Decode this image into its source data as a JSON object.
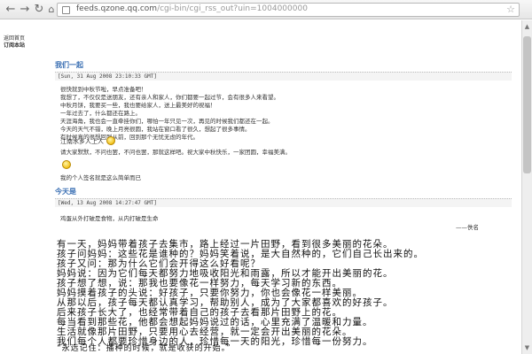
{
  "browser": {
    "back_glyph": "←",
    "forward_glyph": "→",
    "refresh_glyph": "↻",
    "home_glyph": "⌂",
    "url_host": "feeds.qzone.qq.com",
    "url_rest": "/cgi-bin/cgi_rss_out?uin=1004000000",
    "star_glyph": "☆"
  },
  "side_links": {
    "line1": "返回首页",
    "line2": "订阅本站"
  },
  "post1": {
    "title": "我们一起",
    "date": "[Sun, 31 Aug 2008 23:10:33 GMT]",
    "lines": [
      "很快就到中秋节啦，早点准备吧！",
      "我想了，不仅仅是送朋友，还有亲人和家人，你们都要一起过节，会有很多人来看望。",
      "中秋月饼，我要买一些，我也要给家人，送上最美好的祝福！",
      "一年过去了，什么都还在路上。",
      "天涯海角，我也会一直牵挂你们，哪怕一年只见一次，再见的时候我们都还在一起。",
      "今天的天气不错，晚上月亮很圆，我站在窗口看了很久，想起了很多事情。",
      "有时候真的很想回到从前，回到那个无忧无虑的年代。"
    ],
    "tagline": "江南水乡人上人",
    "footer_line": "请大家默默，不问也罢，不问也罢，那就这样吧。祝大家中秋快乐，一家团圆，幸福美满。",
    "sig": "我的个人签名就是这么简单而已"
  },
  "post2": {
    "title": "今天是",
    "date": "[Wed, 13 Aug 2008 14:27:47 GMT]",
    "quote": "鸡蛋从外打破是食物，从内打破是生命",
    "attribution": "——佚名"
  },
  "body_lines": [
    "有一天，妈妈带着孩子去集市，路上经过一片田野，看到很多美丽的花朵。",
    "孩子问妈妈：这些花是谁种的？妈妈笑着说，是大自然种的，它们自己长出来的。",
    "孩子又问：那为什么它们会开得这么好看呢？",
    "妈妈说：因为它们每天都努力地吸收阳光和雨露，所以才能开出美丽的花。",
    "孩子想了想，说：那我也要像花一样努力，每天学习新的东西。",
    "妈妈摸着孩子的头说：好孩子，只要你努力，你也会像花一样美丽。",
    "从那以后，孩子每天都认真学习，帮助别人，成为了大家都喜欢的好孩子。",
    "后来孩子长大了，也经常带着自己的孩子去看那片田野上的花。",
    "每当看到那些花，他都会想起妈妈说过的话，心里充满了温暖和力量。",
    "生活就像那片田野，只要用心去经营，就一定会开出美丽的花朵。",
    "我们每个人都要珍惜身边的人，珍惜每一天的阳光，珍惜每一份努力。",
    "“永远记住：播种的时候，就是收获的开始。”"
  ]
}
